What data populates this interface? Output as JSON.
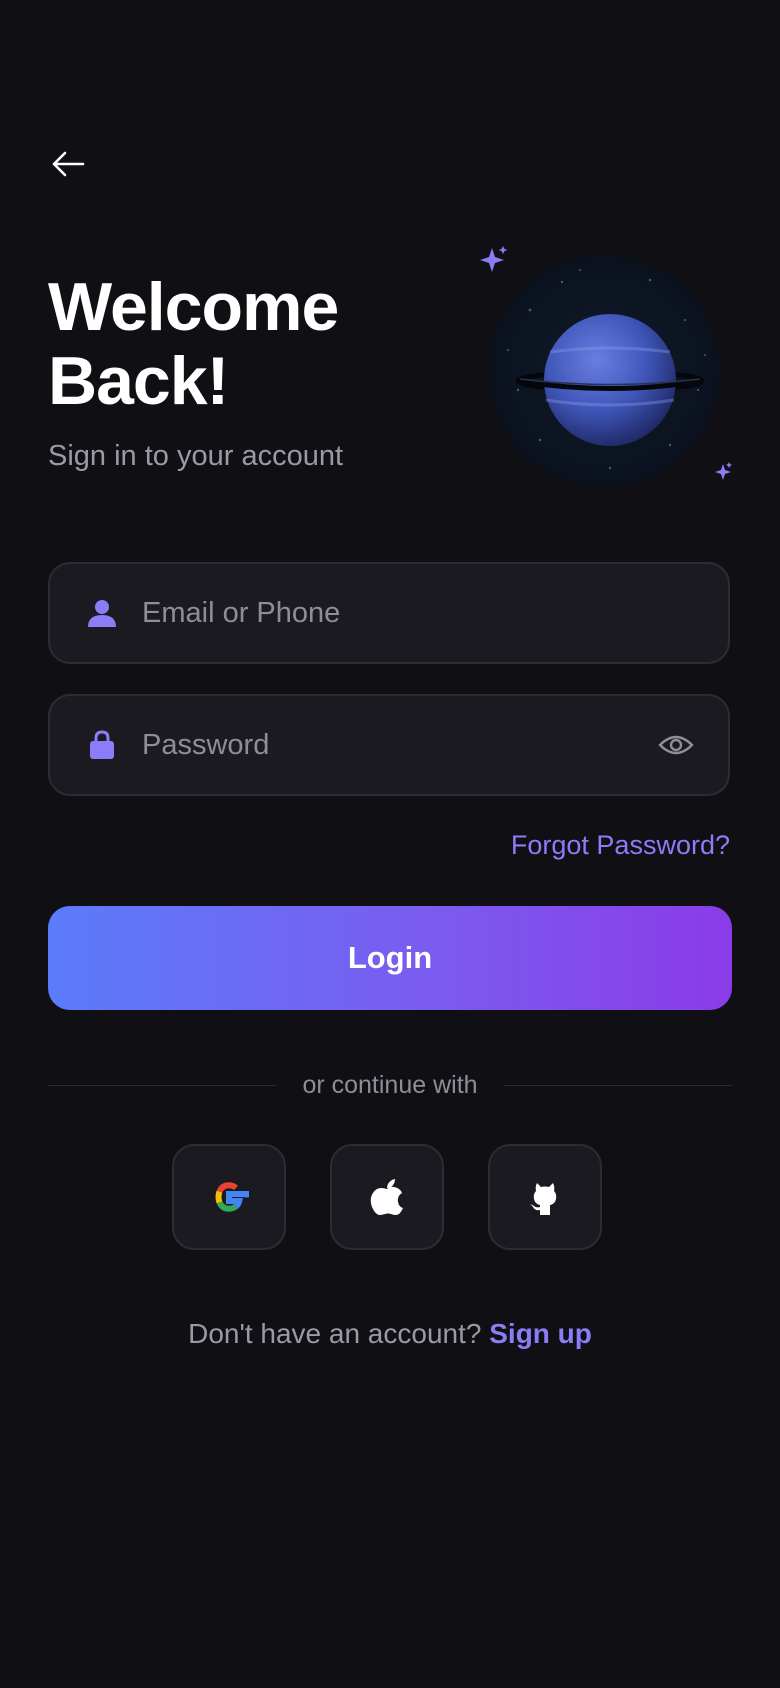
{
  "header": {
    "back_icon": "arrow-left-icon",
    "title_line1": "Welcome",
    "title_line2": "Back!",
    "subtitle": "Sign in to your account"
  },
  "illustration": {
    "name": "planet-illustration"
  },
  "form": {
    "email_placeholder": "Email or Phone",
    "email_icon": "user-icon",
    "password_placeholder": "Password",
    "password_icon": "lock-icon",
    "visibility_icon": "eye-icon",
    "forgot_label": "Forgot Password?",
    "login_label": "Login"
  },
  "divider": {
    "label": "or continue with"
  },
  "social": [
    {
      "name": "google",
      "icon": "google-icon"
    },
    {
      "name": "apple",
      "icon": "apple-icon"
    },
    {
      "name": "github",
      "icon": "github-icon"
    }
  ],
  "footer": {
    "prompt": "Don't have an account?",
    "signup_label": "Sign up"
  },
  "colors": {
    "background": "#0f0f14",
    "accent": "#8b7cf8",
    "field_bg": "#1a1a20",
    "gradient_start": "#5b7cfa",
    "gradient_end": "#8b3be9"
  }
}
